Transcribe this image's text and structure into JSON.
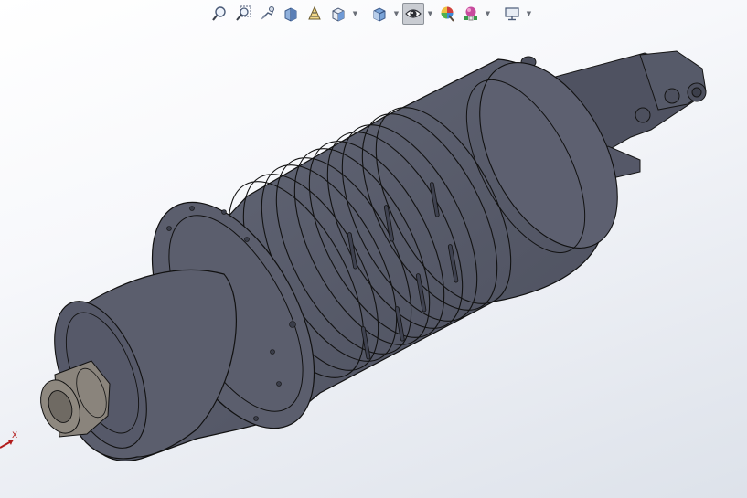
{
  "app": "3D CAD viewer",
  "toolbar": {
    "items": [
      {
        "icon": "zoom-to-fit-icon",
        "dropdown": false
      },
      {
        "icon": "zoom-to-area-icon",
        "dropdown": false
      },
      {
        "icon": "previous-view-icon",
        "dropdown": false
      },
      {
        "icon": "section-view-icon",
        "dropdown": false
      },
      {
        "icon": "dynamic-annotation-icon",
        "dropdown": false
      },
      {
        "icon": "view-orientation-icon",
        "dropdown": true
      },
      {
        "icon": "display-style-icon",
        "dropdown": true
      },
      {
        "icon": "hide-show-items-icon",
        "dropdown": true,
        "active": true
      },
      {
        "icon": "edit-appearance-icon",
        "dropdown": false
      },
      {
        "icon": "apply-scene-icon",
        "dropdown": true
      },
      {
        "icon": "view-settings-icon",
        "dropdown": true
      }
    ]
  },
  "triad": {
    "x_label": "X",
    "x_color": "#b21b1b"
  },
  "model": {
    "body_color": "#5b5e6d",
    "shade_color": "#474a58",
    "nose_color": "#8a847c"
  }
}
